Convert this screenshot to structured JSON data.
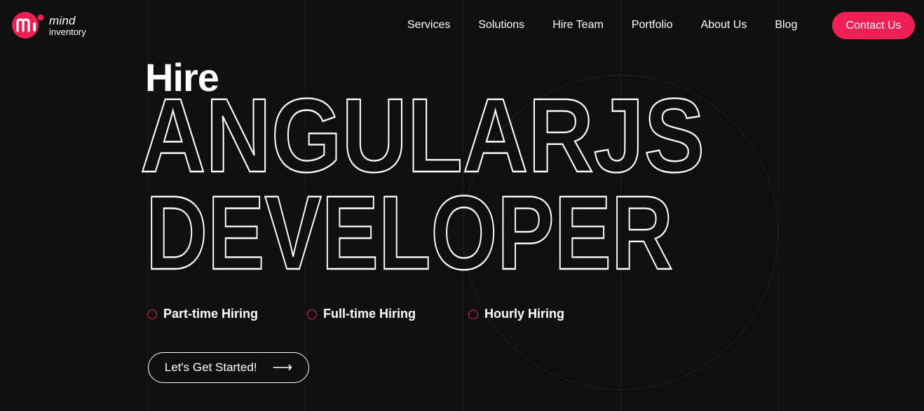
{
  "header": {
    "logo": {
      "line1": "mind",
      "line2": "inventory",
      "mark_letters": "mi",
      "brand_color": "#ee1f55"
    },
    "nav": [
      {
        "label": "Services"
      },
      {
        "label": "Solutions"
      },
      {
        "label": "Hire Team"
      },
      {
        "label": "Portfolio"
      },
      {
        "label": "About Us"
      },
      {
        "label": "Blog"
      }
    ],
    "contact_label": "Contact Us"
  },
  "hero": {
    "hire": "Hire",
    "line1": "ANGULARJS",
    "line2": "DEVELOPER",
    "options": [
      {
        "label": "Part-time Hiring"
      },
      {
        "label": "Full-time Hiring"
      },
      {
        "label": "Hourly Hiring"
      }
    ],
    "cta_label": "Let's Get Started!",
    "cta_icon": "arrow-right-icon"
  },
  "colors": {
    "background": "#0f0f10",
    "accent": "#ee1f55",
    "text": "#ffffff"
  }
}
